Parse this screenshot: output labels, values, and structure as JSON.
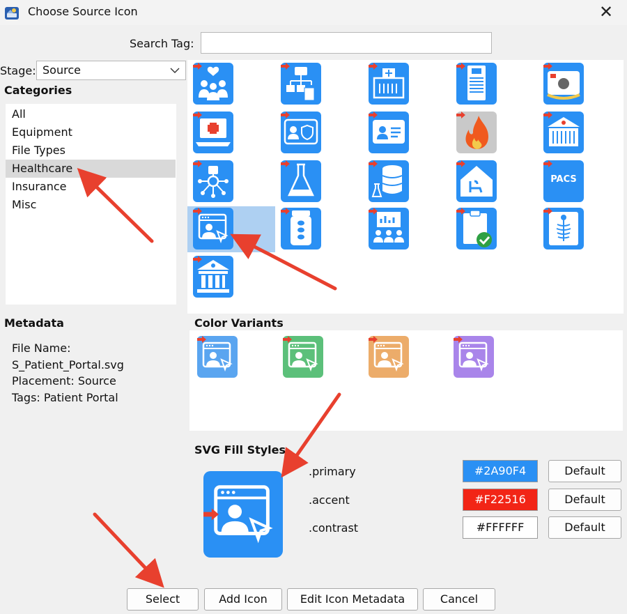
{
  "window": {
    "title": "Choose Source Icon",
    "close_glyph": "✕"
  },
  "search": {
    "label": "Search Tag:",
    "value": ""
  },
  "stage": {
    "label": "Stage:",
    "selected": "Source"
  },
  "categories": {
    "title": "Categories",
    "items": [
      {
        "label": "All"
      },
      {
        "label": "Equipment"
      },
      {
        "label": "File Types"
      },
      {
        "label": "Healthcare",
        "selected": true
      },
      {
        "label": "Insurance"
      },
      {
        "label": "Misc"
      }
    ]
  },
  "icon_grid": {
    "icons": [
      {
        "name": "care-community-icon"
      },
      {
        "name": "hospital-org-chart-icon"
      },
      {
        "name": "hospital-building-icon"
      },
      {
        "name": "medical-device-tower-icon"
      },
      {
        "name": "medical-scanner-icon"
      },
      {
        "name": "laptop-medical-icon"
      },
      {
        "name": "id-card-shield-icon"
      },
      {
        "name": "contact-card-icon"
      },
      {
        "name": "fire-icon"
      },
      {
        "name": "hospital-facade-icon"
      },
      {
        "name": "medical-network-icon"
      },
      {
        "name": "lab-flask-icon"
      },
      {
        "name": "lab-database-icon"
      },
      {
        "name": "home-care-icon"
      },
      {
        "name": "pacs-icon",
        "text": "PACS"
      },
      {
        "name": "patient-portal-icon",
        "selected": true
      },
      {
        "name": "pill-bottle-icon"
      },
      {
        "name": "presentation-group-icon"
      },
      {
        "name": "clipboard-check-icon"
      },
      {
        "name": "xray-icon"
      },
      {
        "name": "institution-icon"
      }
    ]
  },
  "metadata": {
    "title": "Metadata",
    "lines": [
      "File Name:",
      "S_Patient_Portal.svg",
      "Placement: Source",
      "Tags: Patient Portal"
    ]
  },
  "color_variants": {
    "title": "Color Variants",
    "colors": [
      "#5aa5f0",
      "#5cc07a",
      "#ecac6a",
      "#a985ea"
    ]
  },
  "fill_styles": {
    "title": "SVG Fill Styles",
    "rows": [
      {
        "label": ".primary",
        "value": "#2A90F4",
        "color": "#2A90F4",
        "text_color": "#ffffff",
        "button": "Default"
      },
      {
        "label": ".accent",
        "value": "#F22516",
        "color": "#F22516",
        "text_color": "#ffffff",
        "button": "Default"
      },
      {
        "label": ".contrast",
        "value": "#FFFFFF",
        "color": "#FFFFFF",
        "text_color": "#111111",
        "button": "Default"
      }
    ]
  },
  "buttons": {
    "select": "Select",
    "add_icon": "Add Icon",
    "edit_metadata": "Edit Icon Metadata",
    "cancel": "Cancel"
  },
  "colors": {
    "primary": "#2A90F4",
    "accent": "#F22516",
    "annotation_arrow": "#e8402e",
    "selection": "#aed0f2"
  }
}
